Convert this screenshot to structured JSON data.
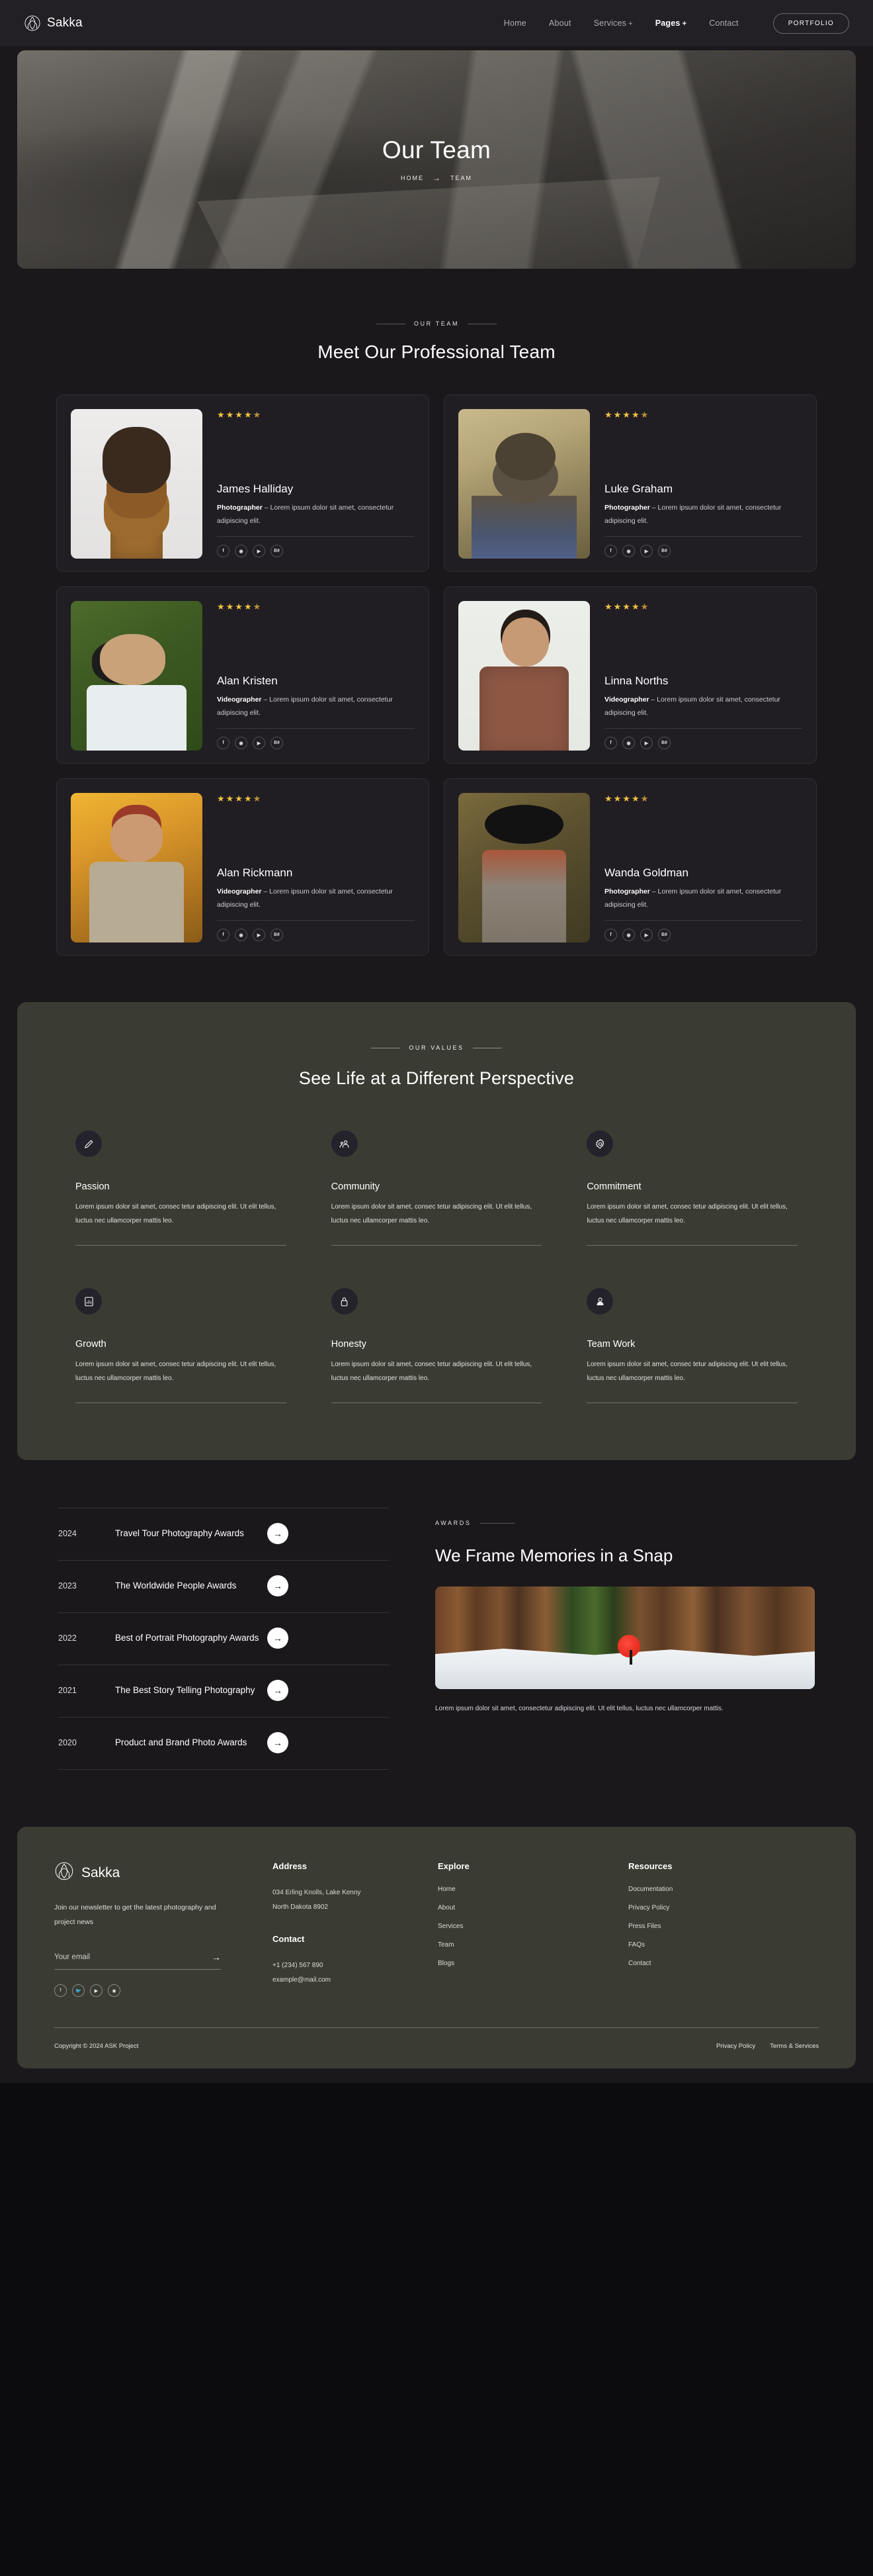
{
  "header": {
    "brand": "Sakka",
    "logo_icon": "lotus-logo-icon",
    "nav": [
      {
        "label": "Home",
        "has_plus": false,
        "active": false
      },
      {
        "label": "About",
        "has_plus": false,
        "active": false
      },
      {
        "label": "Services",
        "has_plus": true,
        "active": false
      },
      {
        "label": "Pages",
        "has_plus": true,
        "active": true
      },
      {
        "label": "Contact",
        "has_plus": false,
        "active": false
      }
    ],
    "cta": "PORTFOLIO"
  },
  "hero": {
    "title": "Our Team",
    "breadcrumb_home": "HOME",
    "breadcrumb_arrow": "→",
    "breadcrumb_current": "TEAM"
  },
  "team_section": {
    "eyebrow": "OUR TEAM",
    "title": "Meet Our Professional Team",
    "members": [
      {
        "name": "James Halliday",
        "role": "Photographer",
        "desc": " – Lorem ipsum dolor sit amet, consectetur adipiscing elit.",
        "rating": "4.5"
      },
      {
        "name": "Luke Graham",
        "role": "Photographer",
        "desc": " – Lorem ipsum dolor sit amet, consectetur adipiscing elit.",
        "rating": "4.5"
      },
      {
        "name": "Alan Kristen",
        "role": "Videographer",
        "desc": " – Lorem ipsum dolor sit amet, consectetur adipiscing elit.",
        "rating": "4.5"
      },
      {
        "name": "Linna Norths",
        "role": "Videographer",
        "desc": " – Lorem ipsum dolor sit amet, consectetur adipiscing elit.",
        "rating": "4.5"
      },
      {
        "name": "Alan Rickmann",
        "role": "Videographer",
        "desc": " – Lorem ipsum dolor sit amet, consectetur adipiscing elit.",
        "rating": "4.5"
      },
      {
        "name": "Wanda Goldman",
        "role": "Photographer",
        "desc": " – Lorem ipsum dolor sit amet, consectetur adipiscing elit.",
        "rating": "4.5"
      }
    ],
    "social_icons": [
      "facebook-icon",
      "dribbble-icon",
      "youtube-icon",
      "behance-icon"
    ],
    "social_labels": [
      "f",
      "",
      "",
      "Bē"
    ]
  },
  "values_section": {
    "eyebrow": "OUR VALUES",
    "title": "See Life at a Different Perspective",
    "items": [
      {
        "title": "Passion",
        "icon": "pencil-icon",
        "desc": "Lorem ipsum dolor sit amet, consec tetur adipiscing elit. Ut elit tellus, luctus nec ullamcorper mattis leo."
      },
      {
        "title": "Community",
        "icon": "people-icon",
        "desc": "Lorem ipsum dolor sit amet, consec tetur adipiscing elit. Ut elit tellus, luctus nec ullamcorper mattis leo."
      },
      {
        "title": "Commitment",
        "icon": "gear-icon",
        "desc": "Lorem ipsum dolor sit amet, consec tetur adipiscing elit. Ut elit tellus, luctus nec ullamcorper mattis leo."
      },
      {
        "title": "Growth",
        "icon": "chart-icon",
        "desc": "Lorem ipsum dolor sit amet, consec tetur adipiscing elit. Ut elit tellus, luctus nec ullamcorper mattis leo."
      },
      {
        "title": "Honesty",
        "icon": "lock-icon",
        "desc": "Lorem ipsum dolor sit amet, consec tetur adipiscing elit. Ut elit tellus, luctus nec ullamcorper mattis leo."
      },
      {
        "title": "Team Work",
        "icon": "user-icon",
        "desc": "Lorem ipsum dolor sit amet, consec tetur adipiscing elit. Ut elit tellus, luctus nec ullamcorper mattis leo."
      }
    ]
  },
  "awards_section": {
    "eyebrow": "AWARDS",
    "title": "We Frame Memories in a Snap",
    "caption": "Lorem ipsum dolor sit amet, consectetur adipiscing elit. Ut elit tellus, luctus nec ullamcorper mattis.",
    "arrow_icon": "arrow-right-icon",
    "rows": [
      {
        "year": "2024",
        "title": "Travel Tour Photography Awards"
      },
      {
        "year": "2023",
        "title": "The Worldwide People Awards"
      },
      {
        "year": "2022",
        "title": "Best of Portrait Photography Awards"
      },
      {
        "year": "2021",
        "title": "The Best Story Telling Photography"
      },
      {
        "year": "2020",
        "title": "Product and Brand Photo Awards"
      }
    ]
  },
  "footer": {
    "brand": "Sakka",
    "logo_icon": "lotus-logo-icon",
    "newsletter_text": "Join our newsletter to get the latest photography and project news",
    "email_placeholder": "Your email",
    "email_value": "",
    "submit_icon": "arrow-right-icon",
    "socials": [
      {
        "icon": "facebook-icon",
        "glyph": "f"
      },
      {
        "icon": "twitter-icon",
        "glyph": ""
      },
      {
        "icon": "youtube-icon",
        "glyph": ""
      },
      {
        "icon": "dribbble-icon",
        "glyph": ""
      }
    ],
    "address_heading": "Address",
    "address_line1": "034 Erling Knolls, Lake Kenny",
    "address_line2": "North Dakota 8902",
    "contact_heading": "Contact",
    "contact_phone": "+1 (234) 567 890",
    "contact_email": "example@mail.com",
    "explore_heading": "Explore",
    "explore_links": [
      "Home",
      "About",
      "Services",
      "Team",
      "Blogs"
    ],
    "resources_heading": "Resources",
    "resources_links": [
      "Documentation",
      "Privacy Policy",
      "Press Files",
      "FAQs",
      "Contact"
    ],
    "copyright": "Copyright © 2024 ASK Project",
    "bottom_links": [
      "Privacy Policy",
      "Terms & Services"
    ]
  },
  "colors": {
    "page_bg": "#1b181c",
    "header_bg": "#221f25",
    "card_bg": "#201d23",
    "panel_bg": "#3a3c33",
    "star": "#f2c240",
    "text": "#ffffff"
  }
}
